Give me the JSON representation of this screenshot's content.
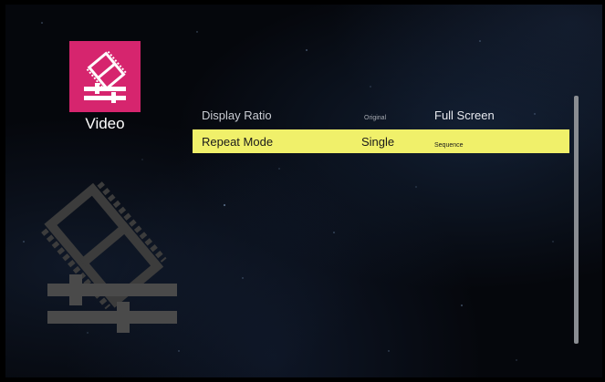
{
  "category": {
    "label": "Video",
    "tile_color": "#d6256e",
    "icon": "film-slider-icon"
  },
  "settings": [
    {
      "name": "Display Ratio",
      "options": [
        "Original",
        "Full Screen"
      ],
      "selected": "Full Screen"
    },
    {
      "name": "Repeat Mode",
      "options": [
        "Single",
        "Sequence"
      ],
      "selected": "Single",
      "highlighted": true
    }
  ],
  "colors": {
    "highlight": "#f0f06a",
    "background": "#05070c"
  }
}
